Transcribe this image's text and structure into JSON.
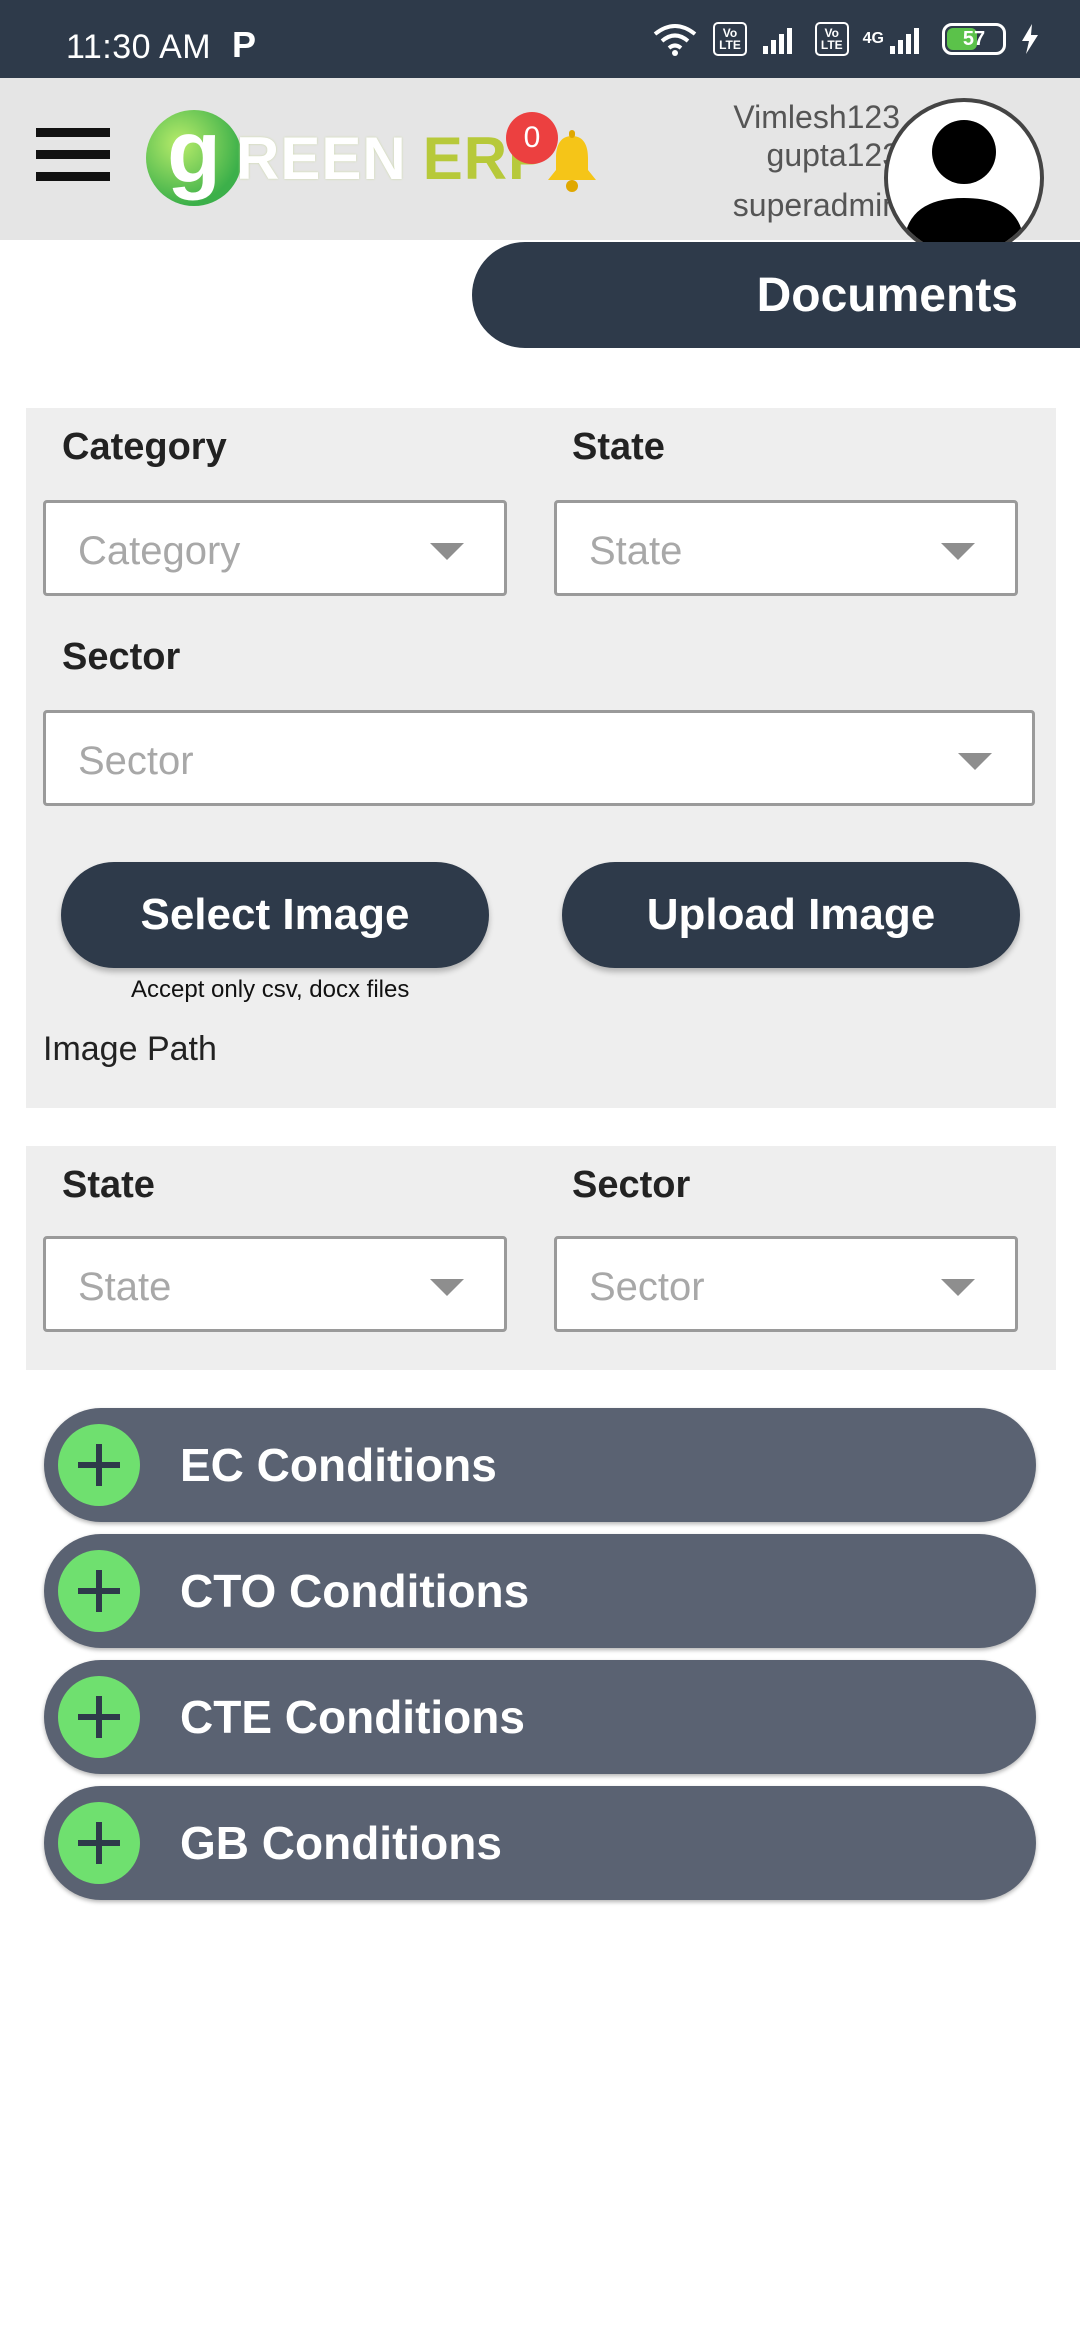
{
  "status_bar": {
    "time": "11:30 AM",
    "p_icon": "P",
    "volte1": "Vo\nLTE",
    "volte2": "Vo\nLTE",
    "network": "4G",
    "battery": "57",
    "battery_level": 0.57
  },
  "header": {
    "logo_g": "g",
    "logo_reen": "REEN",
    "logo_erp": "ERP",
    "notification_count": "0",
    "user_name_line1": "Vimlesh123",
    "user_name_line2": "gupta123",
    "user_role": "superadmin"
  },
  "page_title": "Documents",
  "upload_panel": {
    "category_label": "Category",
    "category_placeholder": "Category",
    "state_label": "State",
    "state_placeholder": "State",
    "sector_label": "Sector",
    "sector_placeholder": "Sector",
    "select_image_button": "Select Image",
    "upload_image_button": "Upload Image",
    "accept_hint": "Accept only csv, docx files",
    "image_path_label": "Image Path"
  },
  "filter_panel": {
    "state_label": "State",
    "state_placeholder": "State",
    "sector_label": "Sector",
    "sector_placeholder": "Sector"
  },
  "conditions": [
    {
      "label": "EC Conditions"
    },
    {
      "label": "CTO Conditions"
    },
    {
      "label": "CTE Conditions"
    },
    {
      "label": "GB Conditions"
    }
  ],
  "colors": {
    "dark_navy": "#2e3a4a",
    "accordion": "#5a6272",
    "plus_green": "#6fe06f",
    "badge_red": "#ec4040"
  }
}
